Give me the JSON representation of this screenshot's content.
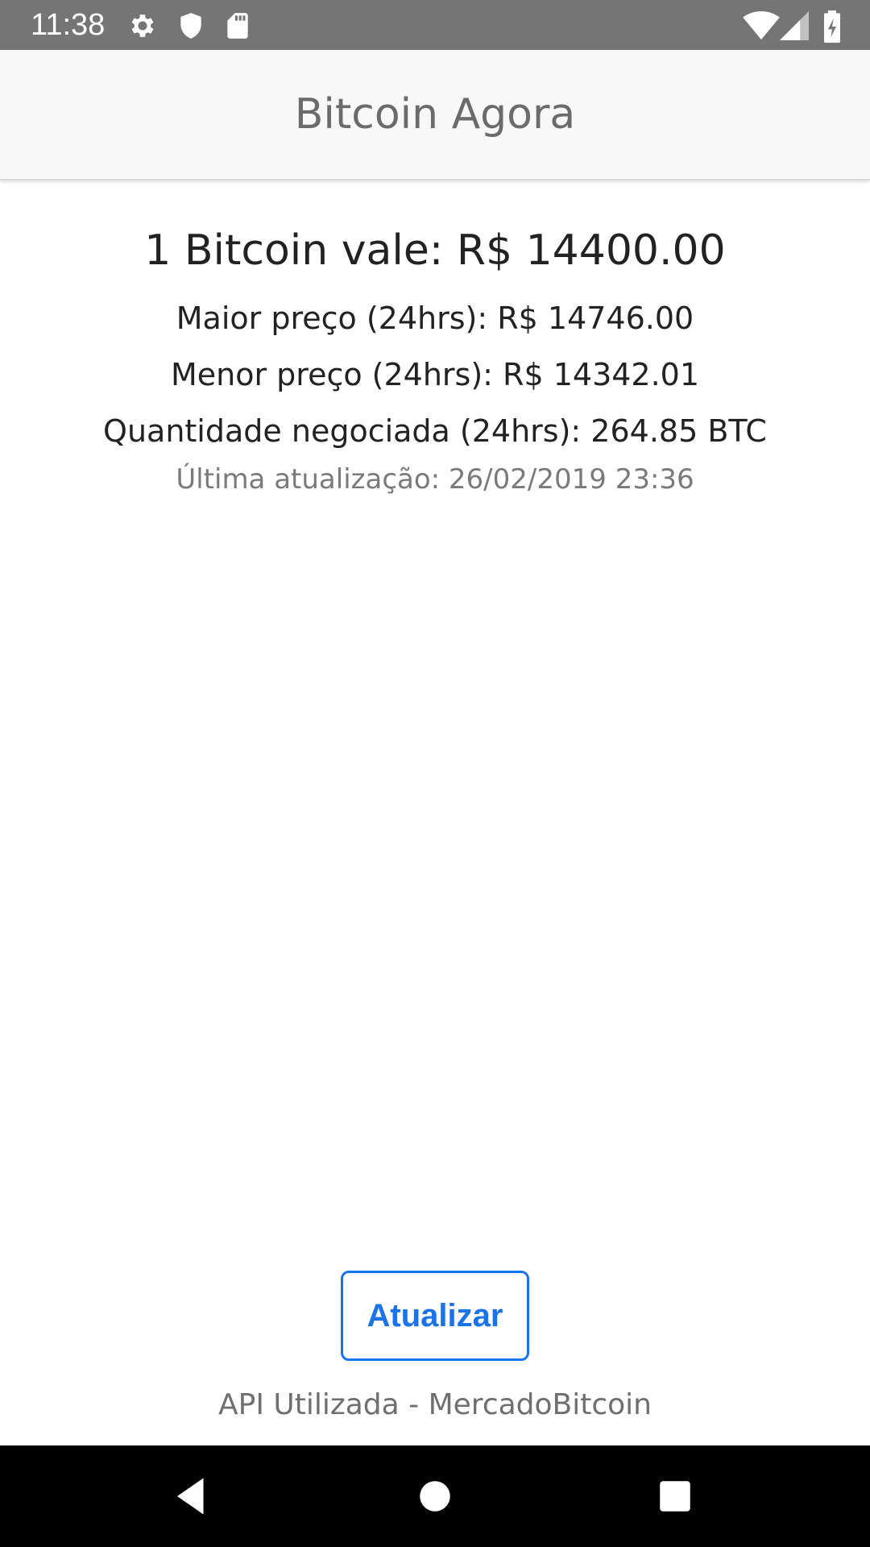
{
  "status_bar": {
    "time": "11:38",
    "icons": [
      "gear-icon",
      "shield-icon",
      "sd-card-icon",
      "wifi-icon",
      "signal-icon",
      "battery-charging-icon"
    ],
    "background": "#757575"
  },
  "app_bar": {
    "title": "Bitcoin Agora",
    "background": "#f8f8f8"
  },
  "prices": {
    "main": "1 Bitcoin vale: R$ 14400.00",
    "high": "Maior preço (24hrs): R$ 14746.00",
    "low": "Menor preço (24hrs): R$ 14342.01",
    "volume": "Quantidade negociada (24hrs): 264.85 BTC",
    "updated": "Última atualização: 26/02/2019 23:36"
  },
  "actions": {
    "refresh_label": "Atualizar",
    "accent": "#1a73e8"
  },
  "footer": {
    "api_text": "API Utilizada - MercadoBitcoin"
  },
  "nav_bar": {
    "icons": [
      "back-icon",
      "home-icon",
      "recents-icon"
    ]
  }
}
